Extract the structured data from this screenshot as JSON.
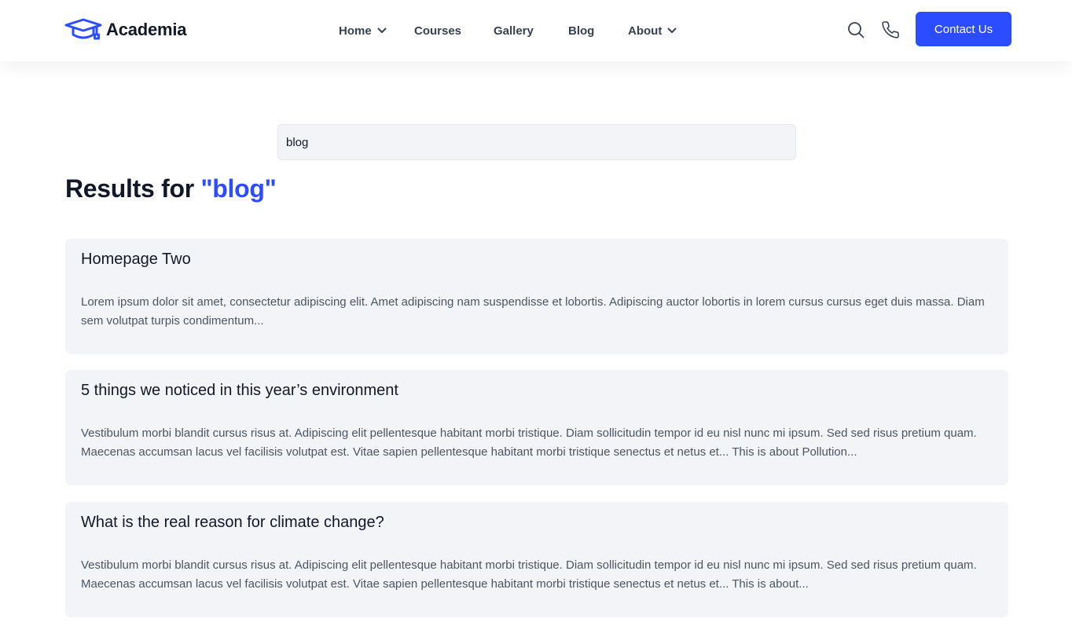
{
  "colors": {
    "accent": "#2b4cff",
    "text_dark": "#111827",
    "text_muted": "#4b5563",
    "card_bg": "#f3f4f7"
  },
  "header": {
    "logo_icon": "graduation-cap-icon",
    "brand": "Academia",
    "nav": [
      {
        "label": "Home",
        "has_dropdown": true
      },
      {
        "label": "Courses",
        "has_dropdown": false
      },
      {
        "label": "Gallery",
        "has_dropdown": false
      },
      {
        "label": "Blog",
        "has_dropdown": false
      },
      {
        "label": "About",
        "has_dropdown": true
      }
    ],
    "icons": [
      "search-icon",
      "phone-icon"
    ],
    "contact_label": "Contact Us"
  },
  "search": {
    "value": "blog"
  },
  "results": {
    "heading_prefix": "Results for ",
    "query_display": "\"blog\"",
    "items": [
      {
        "title": "Homepage Two",
        "excerpt": "Lorem ipsum dolor sit amet, consectetur adipiscing elit. Amet adipiscing nam suspendisse et lobortis. Adipiscing auctor lobortis in lorem cursus cursus eget duis massa. Diam sem volutpat turpis condimentum..."
      },
      {
        "title": "5 things we noticed in this year’s environment",
        "excerpt": "Vestibulum morbi blandit cursus risus at. Adipiscing elit pellentesque habitant morbi tristique. Diam sollicitudin tempor id eu nisl nunc mi ipsum. Sed sed risus pretium quam. Maecenas accumsan lacus vel facilisis volutpat est. Vitae sapien pellentesque habitant morbi tristique senectus et netus et... This is about Pollution..."
      },
      {
        "title": "What is the real reason for climate change?",
        "excerpt": "Vestibulum morbi blandit cursus risus at. Adipiscing elit pellentesque habitant morbi tristique. Diam sollicitudin tempor id eu nisl nunc mi ipsum. Sed sed risus pretium quam. Maecenas accumsan lacus vel facilisis volutpat est. Vitae sapien pellentesque habitant morbi tristique senectus et netus et... This is about..."
      }
    ]
  }
}
